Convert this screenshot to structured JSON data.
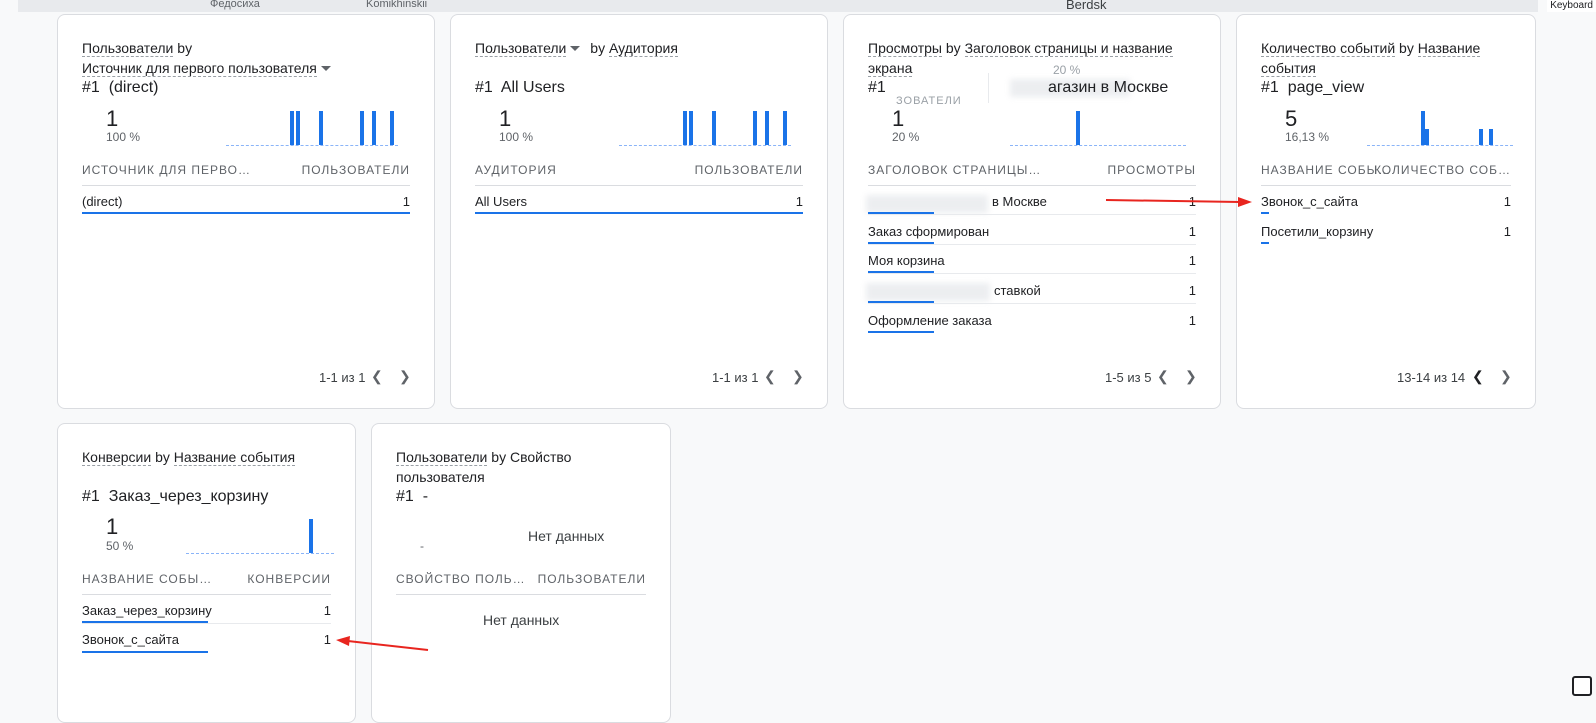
{
  "map": {
    "labels": [
      "Федосиха",
      "Komikhinskii",
      "Berdsk"
    ],
    "keyboard": "Keyboard"
  },
  "cards": {
    "c1": {
      "t1": "Пользователи",
      "by": "by",
      "t2": "Источник для первого пользователя",
      "rank": "#1",
      "rank_label": "(direct)",
      "value": "1",
      "pct": "100 %",
      "col1": "ИСТОЧНИК ДЛЯ ПЕРВО…",
      "col2": "ПОЛЬЗОВАТЕЛИ",
      "rows": [
        {
          "label": "(direct)",
          "value": "1"
        }
      ],
      "pager": "1-1 из 1"
    },
    "c2": {
      "t1": "Пользователи",
      "by": "by",
      "t2": "Аудитория",
      "rank": "#1",
      "rank_label": "All Users",
      "value": "1",
      "pct": "100 %",
      "col1": "АУДИТОРИЯ",
      "col2": "ПОЛЬЗОВАТЕЛИ",
      "rows": [
        {
          "label": "All Users",
          "value": "1"
        }
      ],
      "pager": "1-1 из 1"
    },
    "c3": {
      "t1": "Просмотры",
      "by": "by",
      "t2": "Заголовок страницы и название",
      "t3": "экрана",
      "rank": "#1",
      "rank_label": "агазин в Москве",
      "overlay1": "20 %",
      "overlay2": "ЗОВАТЕЛИ",
      "value": "1",
      "pct": "20 %",
      "col1": "ЗАГОЛОВОК СТРАНИЦЫ…",
      "col2": "ПРОСМОТРЫ",
      "rows": [
        {
          "label": "в Москве",
          "value": "1"
        },
        {
          "label": "Заказ сформирован",
          "value": "1"
        },
        {
          "label": "Моя корзина",
          "value": "1"
        },
        {
          "label": "ставкой",
          "value": "1"
        },
        {
          "label": "Оформление заказа",
          "value": "1"
        }
      ],
      "pager": "1-5 из 5"
    },
    "c4": {
      "t1": "Количество событий",
      "by": "by",
      "t2": "Название",
      "t3": "события",
      "rank": "#1",
      "rank_label": "page_view",
      "value": "5",
      "pct": "16,13 %",
      "col1": "НАЗВАНИЕ СОБЫ…",
      "col2": "КОЛИЧЕСТВО СОБ…",
      "rows": [
        {
          "label": "Звонок_с_сайта",
          "value": "1"
        },
        {
          "label": "Посетили_корзину",
          "value": "1"
        }
      ],
      "pager": "13-14 из 14"
    },
    "c5": {
      "t1": "Конверсии",
      "by": "by",
      "t2": "Название события",
      "rank": "#1",
      "rank_label": "Заказ_через_корзину",
      "value": "1",
      "pct": "50 %",
      "col1": "НАЗВАНИЕ СОБЫ…",
      "col2": "КОНВЕРСИИ",
      "rows": [
        {
          "label": "Заказ_через_корзину",
          "value": "1"
        },
        {
          "label": "Звонок_с_сайта",
          "value": "1"
        }
      ]
    },
    "c6": {
      "t1": "Пользователи",
      "by": "by",
      "t2": "Свойство",
      "t3": "пользователя",
      "rank": "#1",
      "rank_label": "-",
      "dash": "-",
      "nodata1": "Нет данных",
      "col1": "СВОЙСТВО ПОЛЬ…",
      "col2": "ПОЛЬЗОВАТЕЛИ",
      "nodata2": "Нет данных"
    }
  },
  "colors": {
    "accent": "#1a73e8",
    "annotation": "#e8251f"
  }
}
